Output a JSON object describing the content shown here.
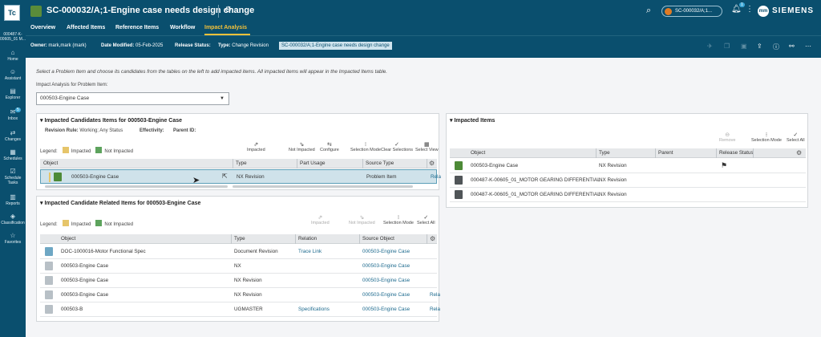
{
  "left_nav": {
    "logo": "Tc",
    "context_lines": [
      "000487-K-",
      "00605_01 M..."
    ],
    "items": [
      {
        "label": "Home",
        "icon": "home-icon",
        "glyph": "⌂"
      },
      {
        "label": "Assistant",
        "icon": "assistant-icon",
        "glyph": "☺"
      },
      {
        "label": "Explorer",
        "icon": "explorer-icon",
        "glyph": "▤"
      },
      {
        "label": "Inbox",
        "icon": "inbox-icon",
        "glyph": "✉",
        "badge": "5"
      },
      {
        "label": "Changes",
        "icon": "changes-icon",
        "glyph": "⇄"
      },
      {
        "label": "Schedules",
        "icon": "schedules-icon",
        "glyph": "▦"
      },
      {
        "label": "Schedule Tasks",
        "icon": "schedule-tasks-icon",
        "glyph": "☑"
      },
      {
        "label": "Reports",
        "icon": "reports-icon",
        "glyph": "▥"
      },
      {
        "label": "Classification",
        "icon": "classification-icon",
        "glyph": "◈"
      },
      {
        "label": "Favorites",
        "icon": "star-icon",
        "glyph": "☆"
      }
    ]
  },
  "header": {
    "title": "SC-000032/A;1-Engine case needs design change",
    "context_pill": "SC-000032/A;1...",
    "avatar": "mm",
    "notif_badge": "1",
    "brand": "SIEMENS"
  },
  "tabs": [
    "Overview",
    "Affected Items",
    "Reference Items",
    "Workflow",
    "Impact Analysis"
  ],
  "active_tab": "Impact Analysis",
  "infobar": {
    "owner_label": "Owner:",
    "owner": "mark,mark (mark)",
    "date_label": "Date Modified:",
    "date": "05-Feb-2025",
    "release_label": "Release Status:",
    "release": "",
    "type_label": "Type:",
    "type": "Change Revision",
    "chip": "SC-000032/A;1-Engine case needs design change"
  },
  "instructions": "Select a Problem Item and choose its candidates from the tables on the left to add impacted items. All impacted items will appear in the Impacted Items table.",
  "impact_label": "Impact Analysis for Problem Item:",
  "impact_select": "000503-Engine Case",
  "legend": {
    "label": "Legend:",
    "impacted": "Impacted",
    "not_impacted": "Not Impacted"
  },
  "candidates": {
    "title": "Impacted Candidates Items for 000503-Engine Case",
    "revision_rule_label": "Revision Rule:",
    "revision_rule": "Working; Any Status",
    "effectivity_label": "Effectivity:",
    "parent_label": "Parent ID:",
    "toolbar": [
      "Impacted",
      "Not Impacted",
      "Configure",
      "Selection Mode",
      "Clear Selections",
      "Select View"
    ],
    "columns": [
      "Object",
      "Type",
      "Part Usage",
      "Source Type"
    ],
    "rows": [
      {
        "object": "000503-Engine Case",
        "type": "NX Revision",
        "part_usage": "",
        "source_type": "Problem Item",
        "extra": "Rela"
      }
    ]
  },
  "related": {
    "title": "Impacted Candidate Related Items for 000503-Engine Case",
    "toolbar": [
      "Impacted",
      "Not Impacted",
      "Selection Mode",
      "Select All"
    ],
    "columns": [
      "Object",
      "Type",
      "Relation",
      "Source Object"
    ],
    "rows": [
      {
        "object": "DOC-1000016-Motor Functional Spec",
        "type": "Document Revision",
        "relation": "Trace Link",
        "source": "000503-Engine Case",
        "extra": ""
      },
      {
        "object": "000503-Engine Case",
        "type": "NX",
        "relation": "",
        "source": "000503-Engine Case",
        "extra": ""
      },
      {
        "object": "000503-Engine Case",
        "type": "NX Revision",
        "relation": "",
        "source": "000503-Engine Case",
        "extra": ""
      },
      {
        "object": "000503-Engine Case",
        "type": "NX Revision",
        "relation": "",
        "source": "000503-Engine Case",
        "extra": "Rela"
      },
      {
        "object": "000503-B",
        "type": "UGMASTER",
        "relation": "Specifications",
        "source": "000503-Engine Case",
        "extra": "Rela"
      }
    ]
  },
  "impacted": {
    "title": "Impacted Items",
    "toolbar": [
      "Remove",
      "Selection Mode",
      "Select All"
    ],
    "columns": [
      "Object",
      "Type",
      "Parent",
      "Release Status"
    ],
    "rows": [
      {
        "object": "000503-Engine Case",
        "type": "NX Revision",
        "parent": "",
        "status_icon": "checkered-flag-icon"
      },
      {
        "object": "000487-K-00605_01_MOTOR GEARING DIFFERENTIAL",
        "type": "NX Revision",
        "parent": "",
        "status_icon": ""
      },
      {
        "object": "000487-K-00605_01_MOTOR GEARING DIFFERENTIAL",
        "type": "NX Revision",
        "parent": "",
        "status_icon": ""
      }
    ]
  }
}
